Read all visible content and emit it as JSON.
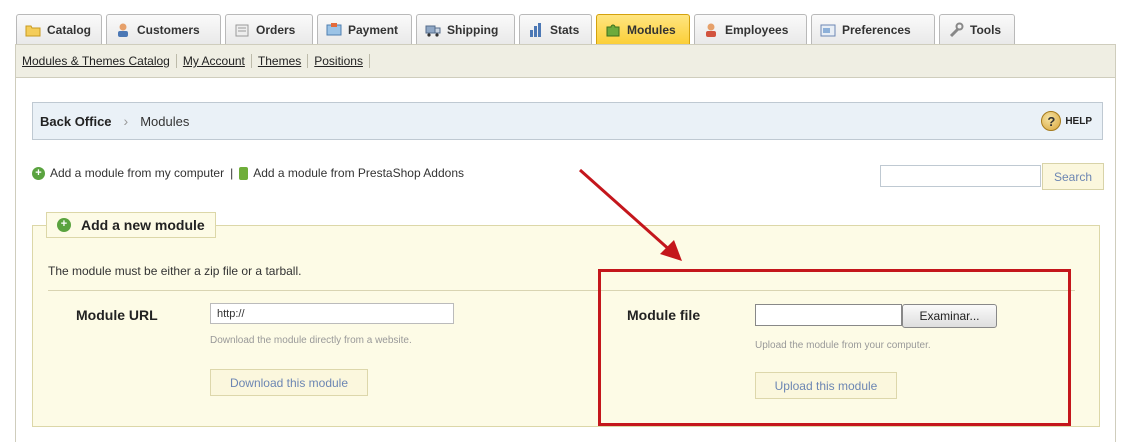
{
  "tabs": [
    {
      "label": "Catalog",
      "icon": "folder-icon",
      "active": false
    },
    {
      "label": "Customers",
      "icon": "customers-icon",
      "active": false
    },
    {
      "label": "Orders",
      "icon": "orders-icon",
      "active": false
    },
    {
      "label": "Payment",
      "icon": "payment-icon",
      "active": false
    },
    {
      "label": "Shipping",
      "icon": "truck-icon",
      "active": false
    },
    {
      "label": "Stats",
      "icon": "stats-icon",
      "active": false
    },
    {
      "label": "Modules",
      "icon": "puzzle-icon",
      "active": true
    },
    {
      "label": "Employees",
      "icon": "employees-icon",
      "active": false
    },
    {
      "label": "Preferences",
      "icon": "preferences-icon",
      "active": false
    },
    {
      "label": "Tools",
      "icon": "wrench-icon",
      "active": false
    }
  ],
  "subnav": [
    "Modules & Themes Catalog",
    "My Account",
    "Themes",
    "Positions"
  ],
  "breadcrumb": {
    "root": "Back Office",
    "current": "Modules",
    "help": "HELP"
  },
  "add_links": {
    "from_computer": "Add a module from my computer",
    "separator": "|",
    "from_addons": "Add a module from PrestaShop Addons"
  },
  "search": {
    "value": "",
    "button": "Search"
  },
  "panel": {
    "legend": "Add a new module",
    "description": "The module must be either a zip file or a tarball.",
    "url_label": "Module URL",
    "url_value": "http://",
    "url_hint": "Download the module directly from a website.",
    "download_button": "Download this module",
    "file_label": "Module file",
    "browse_button": "Examinar...",
    "file_hint": "Upload the module from your computer.",
    "upload_button": "Upload this module"
  },
  "colors": {
    "highlight": "#c4161c",
    "active_tab": "#fbcf38",
    "link_button_text": "#6c86b3"
  }
}
